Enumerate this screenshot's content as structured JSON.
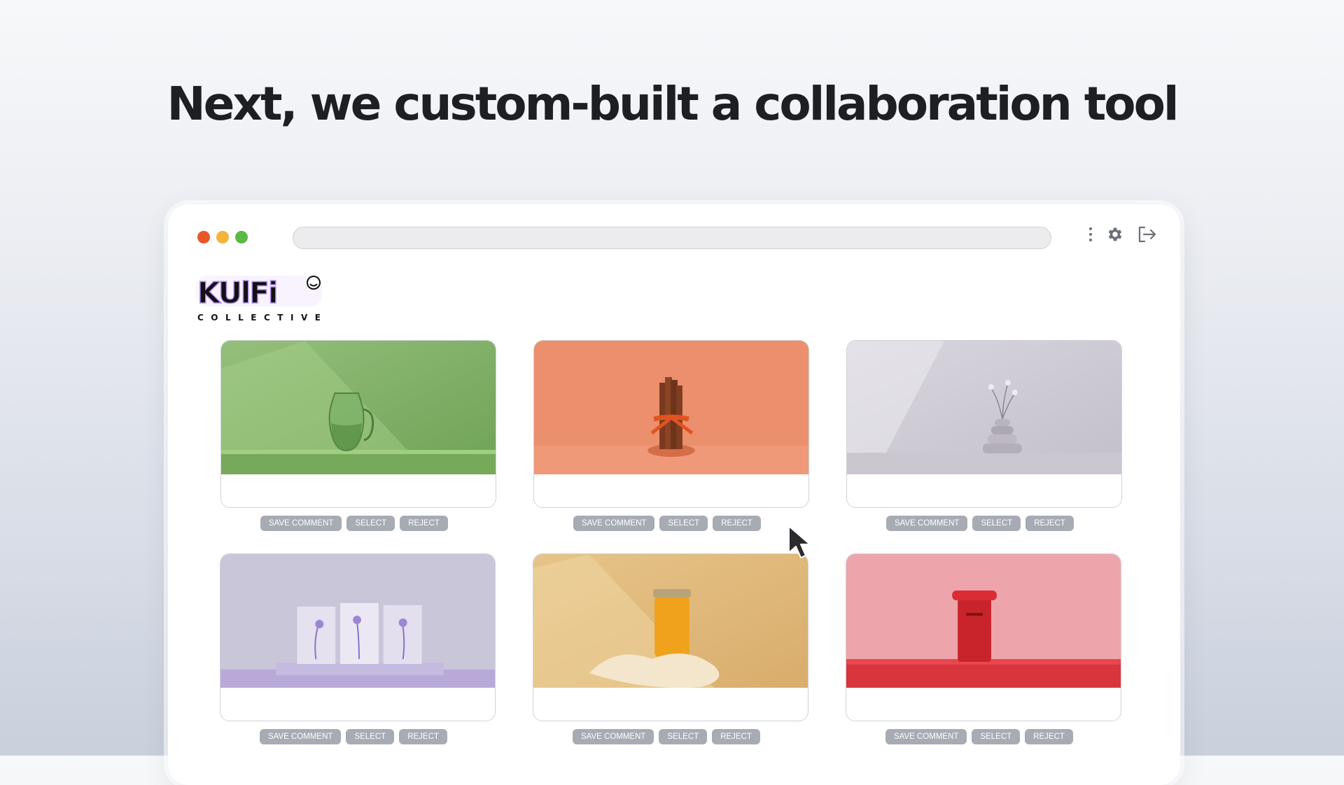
{
  "headline": "Next, we custom-built a collaboration tool",
  "window": {
    "traffic_lights": [
      "#e8572a",
      "#f2b53a",
      "#5bb946"
    ],
    "url_bar_value": "",
    "toolbar_icons": [
      "more-vertical-icon",
      "gear-icon",
      "logout-icon"
    ]
  },
  "logo": {
    "wordmark": "KULFI",
    "subtitle": "COLLECTIVE"
  },
  "cards": [
    {
      "subject": "green-glass-pitcher",
      "comment": "",
      "buttons": {
        "save": "SAVE COMMENT",
        "select": "SELECT",
        "reject": "REJECT"
      }
    },
    {
      "subject": "cinnamon-sticks-bow",
      "comment": "",
      "buttons": {
        "save": "SAVE COMMENT",
        "select": "SELECT",
        "reject": "REJECT"
      }
    },
    {
      "subject": "stacked-bowls-flowers",
      "comment": "",
      "buttons": {
        "save": "SAVE COMMENT",
        "select": "SELECT",
        "reject": "REJECT"
      }
    },
    {
      "subject": "lavender-cards",
      "comment": "",
      "buttons": {
        "save": "SAVE COMMENT",
        "select": "SELECT",
        "reject": "REJECT"
      }
    },
    {
      "subject": "honey-jar-cloth",
      "comment": "",
      "buttons": {
        "save": "SAVE COMMENT",
        "select": "SELECT",
        "reject": "REJECT"
      }
    },
    {
      "subject": "red-post-box",
      "comment": "",
      "buttons": {
        "save": "SAVE COMMENT",
        "select": "SELECT",
        "reject": "REJECT"
      }
    }
  ],
  "colors": {
    "button_bg": "#a7abb3",
    "headline": "#1e1f22"
  }
}
